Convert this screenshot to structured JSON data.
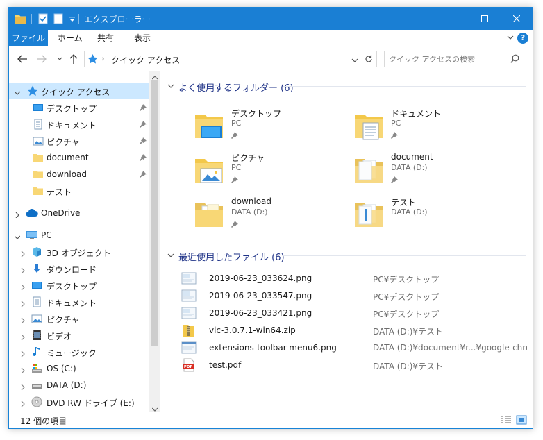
{
  "window": {
    "title": "エクスプローラー",
    "accent": "#1a7fd4"
  },
  "ribbon": {
    "tabs": [
      "ファイル",
      "ホーム",
      "共有",
      "表示"
    ],
    "help_label": "?"
  },
  "address": {
    "crumb_sep": "›",
    "location": "クイック アクセス"
  },
  "search": {
    "placeholder": "クイック アクセスの検索"
  },
  "sidebar": {
    "items": [
      {
        "label": "クイック アクセス",
        "icon": "star-icon"
      },
      {
        "label": "デスクトップ",
        "icon": "desktop-icon"
      },
      {
        "label": "ドキュメント",
        "icon": "document-icon"
      },
      {
        "label": "ピクチャ",
        "icon": "pictures-icon"
      },
      {
        "label": "document",
        "icon": "folder-icon"
      },
      {
        "label": "download",
        "icon": "folder-icon"
      },
      {
        "label": "テスト",
        "icon": "folder-icon"
      },
      {
        "label": "OneDrive",
        "icon": "cloud-icon"
      },
      {
        "label": "PC",
        "icon": "computer-icon"
      },
      {
        "label": "3D オブジェクト",
        "icon": "cube-icon"
      },
      {
        "label": "ダウンロード",
        "icon": "download-arrow-icon"
      },
      {
        "label": "デスクトップ",
        "icon": "desktop-icon"
      },
      {
        "label": "ドキュメント",
        "icon": "document-icon"
      },
      {
        "label": "ピクチャ",
        "icon": "pictures-icon"
      },
      {
        "label": "ビデオ",
        "icon": "video-icon"
      },
      {
        "label": "ミュージック",
        "icon": "music-icon"
      },
      {
        "label": "OS (C:)",
        "icon": "drive-c-icon"
      },
      {
        "label": "DATA (D:)",
        "icon": "drive-icon"
      },
      {
        "label": "DVD RW ドライブ (E:)",
        "icon": "dvd-icon"
      }
    ]
  },
  "content": {
    "frequent_header": "よく使用するフォルダー (6)",
    "recent_header": "最近使用したファイル (6)",
    "folders": [
      {
        "name": "デスクトップ",
        "location": "PC"
      },
      {
        "name": "ドキュメント",
        "location": "PC"
      },
      {
        "name": "ピクチャ",
        "location": "PC"
      },
      {
        "name": "document",
        "location": "DATA (D:)"
      },
      {
        "name": "download",
        "location": "DATA (D:)"
      },
      {
        "name": "テスト",
        "location": "DATA (D:)"
      }
    ],
    "recent": [
      {
        "name": "2019-06-23_033624.png",
        "path": "PC¥デスクトップ"
      },
      {
        "name": "2019-06-23_033547.png",
        "path": "PC¥デスクトップ"
      },
      {
        "name": "2019-06-23_033421.png",
        "path": "PC¥デスクトップ"
      },
      {
        "name": "vlc-3.0.7.1-win64.zip",
        "path": "DATA (D:)¥テスト"
      },
      {
        "name": "extensions-toolbar-menu6.png",
        "path": "DATA (D:)¥document¥r...¥google-chrome"
      },
      {
        "name": "test.pdf",
        "path": "DATA (D:)¥テスト"
      }
    ]
  },
  "status": {
    "item_count": "12 個の項目"
  }
}
